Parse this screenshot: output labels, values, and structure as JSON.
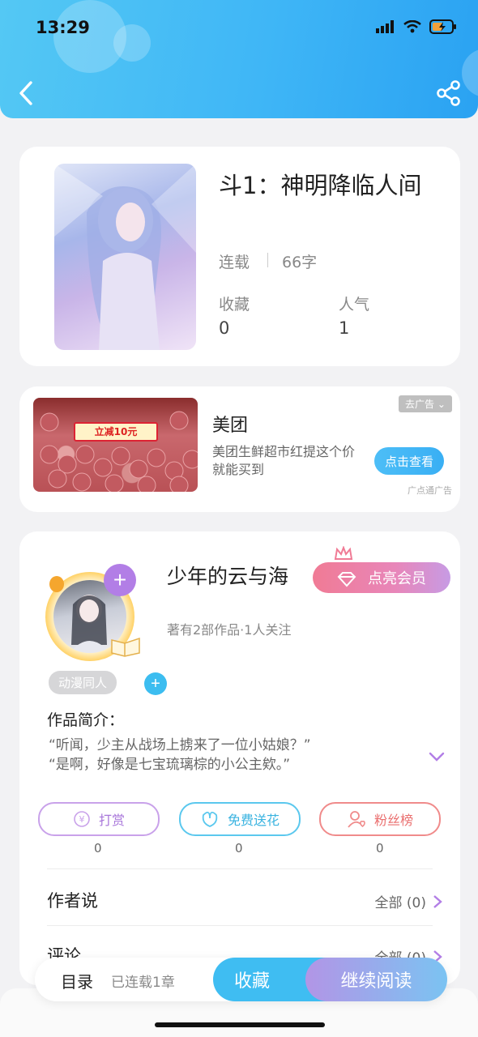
{
  "status_bar": {
    "time": "13:29"
  },
  "colors": {
    "header": "#3fb6f6",
    "accent": "#3fbdf2",
    "purple": "#b27ee6",
    "pink": "#f07b95",
    "reward": "#c9a2ea",
    "flower": "#5bc8ee",
    "fans": "#f08b8b"
  },
  "book": {
    "title": "斗1：神明降临人间",
    "status": "连载",
    "word_count": "66字",
    "stats": [
      {
        "label": "收藏",
        "value": "0"
      },
      {
        "label": "人气",
        "value": "1"
      }
    ]
  },
  "ad": {
    "title": "美团",
    "description": "美团生鲜超市红提这个价就能买到",
    "tag": "去广告",
    "button": "点击查看",
    "source": "广点通广告",
    "banner_text": "立减10元"
  },
  "author": {
    "name": "少年的云与海",
    "vip_button": "点亮会员",
    "meta": "著有2部作品·1人关注",
    "tag": "动漫同人",
    "intro_label": "作品简介：",
    "intro_lines": [
      "“听闻，少主从战场上掳来了一位小姑娘？”",
      "“是啊，好像是七宝琉璃棕的小公主欸。”"
    ]
  },
  "actions": [
    {
      "label": "打赏",
      "count": "0",
      "icon": "coin-icon"
    },
    {
      "label": "免费送花",
      "count": "0",
      "icon": "flower-icon"
    },
    {
      "label": "粉丝榜",
      "count": "0",
      "icon": "fans-icon"
    }
  ],
  "sections": {
    "author_says": {
      "label": "作者说",
      "link": "全部 (0)"
    },
    "comments": {
      "label": "评论",
      "link": "全部 (0)"
    }
  },
  "bottom_bar": {
    "toc_label": "目录",
    "toc_progress": "已连载1章",
    "collect_button": "收藏",
    "read_button": "继续阅读"
  }
}
